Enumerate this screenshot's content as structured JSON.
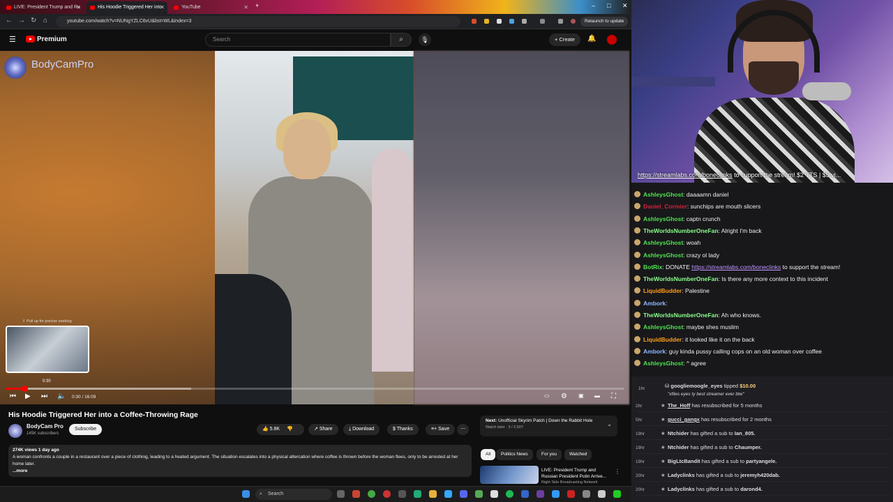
{
  "browser": {
    "tabs": [
      {
        "label": "LIVE: President Trump and Ru"
      },
      {
        "label": "His Hoodie Triggered Her into"
      },
      {
        "label": "YouTube"
      }
    ],
    "url": "youtube.com/watch?v=NUNgYZLC6vU&list=WL&index=3",
    "relaunch_label": "Relaunch to update"
  },
  "youtube": {
    "brand": "Premium",
    "search_placeholder": "Search",
    "create_label": "Create",
    "video": {
      "channel_watermark": "BodyCamPro",
      "pull_up_hint": "Pull up for precise seeking",
      "preview_time": "0:30",
      "time_display": "0:30 / 16:09",
      "progress": 0.031,
      "buffered": 0.3
    },
    "title": "His Hoodie Triggered Her into a Coffee-Throwing Rage",
    "channel": {
      "name": "BodyCam Pro",
      "subscribers": "145K subscribers",
      "subscribe_label": "Subscribe"
    },
    "actions": {
      "likes": "5.8K",
      "share": "Share",
      "download": "Download",
      "thanks": "Thanks",
      "save": "Save"
    },
    "description": {
      "meta": "274K views  1 day ago",
      "text": "A woman confronts a couple in a restaurant over a piece of clothing, leading to a heated argument. The situation escalates into a physical altercation where coffee is thrown before the woman flees, only to be arrested at her home later.",
      "more": "...more"
    },
    "next": {
      "label": "Next:",
      "title": "Unofficial Skyrim Patch | Down the Rabbit Hole",
      "sub": "Watch later · 3 / 2,507"
    },
    "chips": [
      "All",
      "Politics News",
      "For you",
      "Watched"
    ],
    "recommended": {
      "title": "LIVE: President Trump and Russian President Putin Arrive...",
      "channel": "Right Side Broadcasting Network"
    }
  },
  "taskbar": {
    "search": "Search"
  },
  "stream": {
    "link_text": "https://streamlabs.com/boneclinks",
    "link_suffix": " to support the stream! $2 TTS | $5 vi..."
  },
  "chat": [
    {
      "user": "AshleysGhost",
      "color": "#4fe34f",
      "text": "daaaamn daniel"
    },
    {
      "user": "Daniel_Cormier",
      "color": "#d3203b",
      "text": "sunchips are mouth slicers"
    },
    {
      "user": "AshleysGhost",
      "color": "#4fe34f",
      "text": "captn crunch"
    },
    {
      "user": "TheWorldsNumberOneFan",
      "color": "#8aff8a",
      "text": "Alright I'm back"
    },
    {
      "user": "AshleysGhost",
      "color": "#4fe34f",
      "text": "woah"
    },
    {
      "user": "AshleysGhost",
      "color": "#4fe34f",
      "text": "crazy ol lady"
    },
    {
      "user": "BotRix",
      "color": "#4fe34f",
      "text": "DONATE ",
      "link": "https://streamlabs.com/boneclinks",
      "after": " to support the stream!"
    },
    {
      "user": "TheWorldsNumberOneFan",
      "color": "#8aff8a",
      "text": "Is there any more context to this incident"
    },
    {
      "user": "LiquidBudder",
      "color": "#ff9f1c",
      "text": "Palestine"
    },
    {
      "user": "Ambork",
      "color": "#8fb8ff",
      "text": ""
    },
    {
      "user": "TheWorldsNumberOneFan",
      "color": "#8aff8a",
      "text": "Ah who knows."
    },
    {
      "user": "AshleysGhost",
      "color": "#4fe34f",
      "text": "maybe shes muslim"
    },
    {
      "user": "LiquidBudder",
      "color": "#ff9f1c",
      "text": "it looked like it on the back"
    },
    {
      "user": "Ambork",
      "color": "#8fb8ff",
      "text": "guy kinda pussy calling cops on an old woman over coffee"
    },
    {
      "user": "AshleysGhost",
      "color": "#4fe34f",
      "text": "^ agree"
    }
  ],
  "events": {
    "tip": {
      "time": "1hr",
      "user": "googliemoogle_eyes",
      "action": "tipped",
      "amount": "$10.00",
      "message": "\"xfiles eyes ty best streamer ever btw\""
    },
    "list": [
      {
        "time": "2hr",
        "user": "The_Hoff",
        "text": "has resubscribed for 5 months"
      },
      {
        "time": "5hr",
        "user": "gucci_gangx",
        "text": "has resubscribed for 2 months"
      },
      {
        "time": "19hr",
        "user": "Ntchider",
        "text": "has gifted a sub to",
        "target": "Ian_805."
      },
      {
        "time": "19hr",
        "user": "Ntchider",
        "text": "has gifted a sub to",
        "target": "Chaumper."
      },
      {
        "time": "19hr",
        "user": "BigLtcBandit",
        "text": "has gifted a sub to",
        "target": "partyangele."
      },
      {
        "time": "20hr",
        "user": "Ladyclinks",
        "text": "has gifted a sub to",
        "target": "jeremyh420dab."
      },
      {
        "time": "20hr",
        "user": "Ladyclinks",
        "text": "has gifted a sub to",
        "target": "darond4."
      }
    ]
  }
}
